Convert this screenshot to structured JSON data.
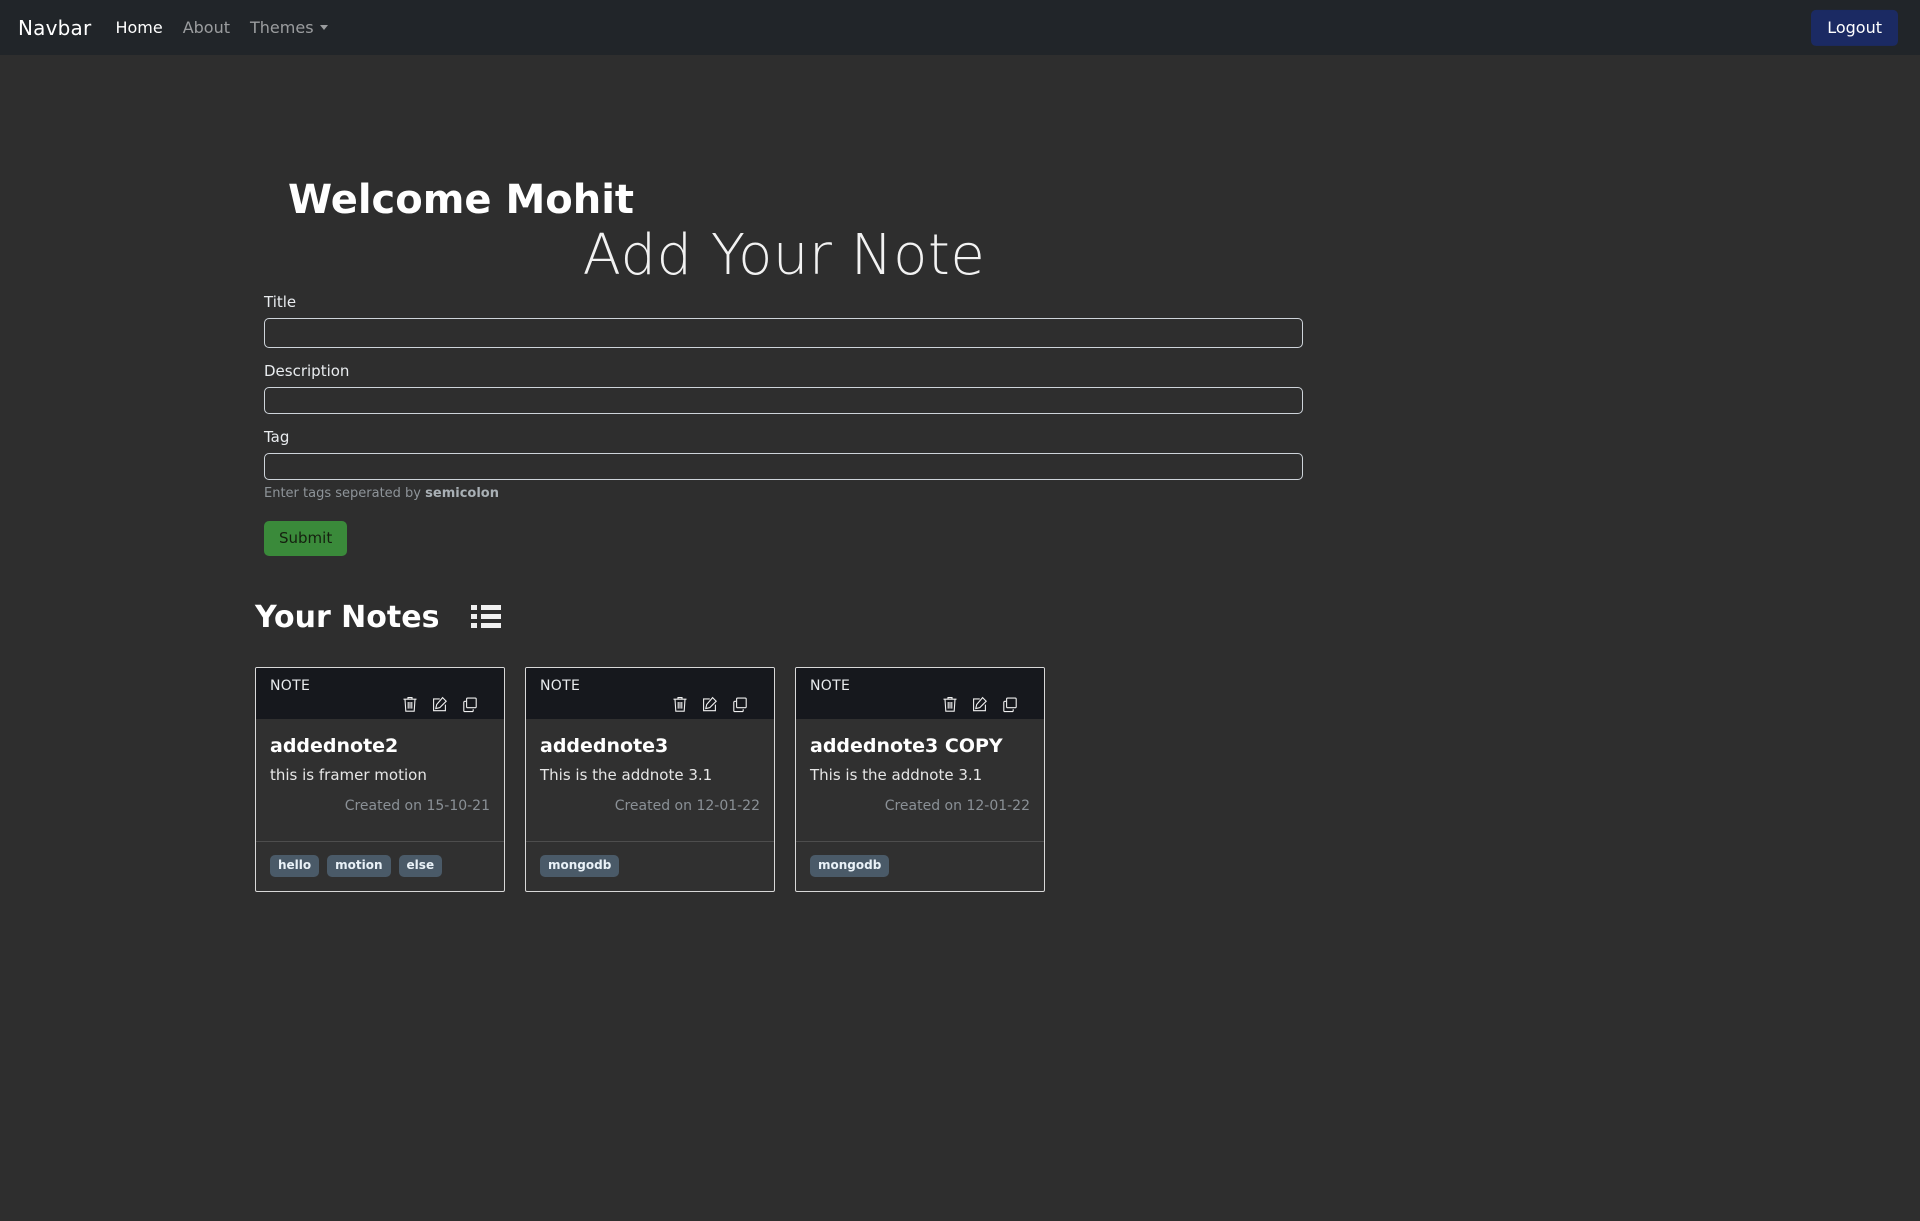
{
  "navbar": {
    "brand": "Navbar",
    "links": [
      {
        "label": "Home",
        "active": true
      },
      {
        "label": "About",
        "active": false
      }
    ],
    "dropdown_label": "Themes",
    "logout_label": "Logout",
    "brand_bg": "#212529",
    "logout_bg": "#1b2a63"
  },
  "header": {
    "welcome": "Welcome Mohit",
    "page_title": "Add Your Note"
  },
  "form": {
    "title": {
      "label": "Title",
      "value": "",
      "placeholder": ""
    },
    "description": {
      "label": "Description",
      "value": "",
      "placeholder": ""
    },
    "tag": {
      "label": "Tag",
      "value": "",
      "placeholder": ""
    },
    "help_prefix": "Enter tags seperated by ",
    "help_bold": "semicolon",
    "submit_label": "Submit",
    "submit_color": "#3a8a3a"
  },
  "notes_section": {
    "heading": "Your Notes",
    "list_icon": "list-icon"
  },
  "cards": [
    {
      "kind": "NOTE",
      "title": "addednote2",
      "description": "this is framer motion",
      "created": "Created on 15-10-21",
      "tags": [
        "hello",
        "motion",
        "else"
      ],
      "actions": [
        "delete-icon",
        "edit-icon",
        "copy-icon"
      ]
    },
    {
      "kind": "NOTE",
      "title": "addednote3",
      "description": "This is the addnote 3.1",
      "created": "Created on 12-01-22",
      "tags": [
        "mongodb"
      ],
      "actions": [
        "delete-icon",
        "edit-icon",
        "copy-icon"
      ]
    },
    {
      "kind": "NOTE",
      "title": "addednote3 COPY",
      "description": "This is the addnote 3.1",
      "created": "Created on 12-01-22",
      "tags": [
        "mongodb"
      ],
      "actions": [
        "delete-icon",
        "edit-icon",
        "copy-icon"
      ]
    }
  ],
  "theme": {
    "page_bg": "#2e2e2e",
    "card_bg": "#303030",
    "card_header_bg": "#16181d",
    "tag_bg": "#4a5a68"
  }
}
